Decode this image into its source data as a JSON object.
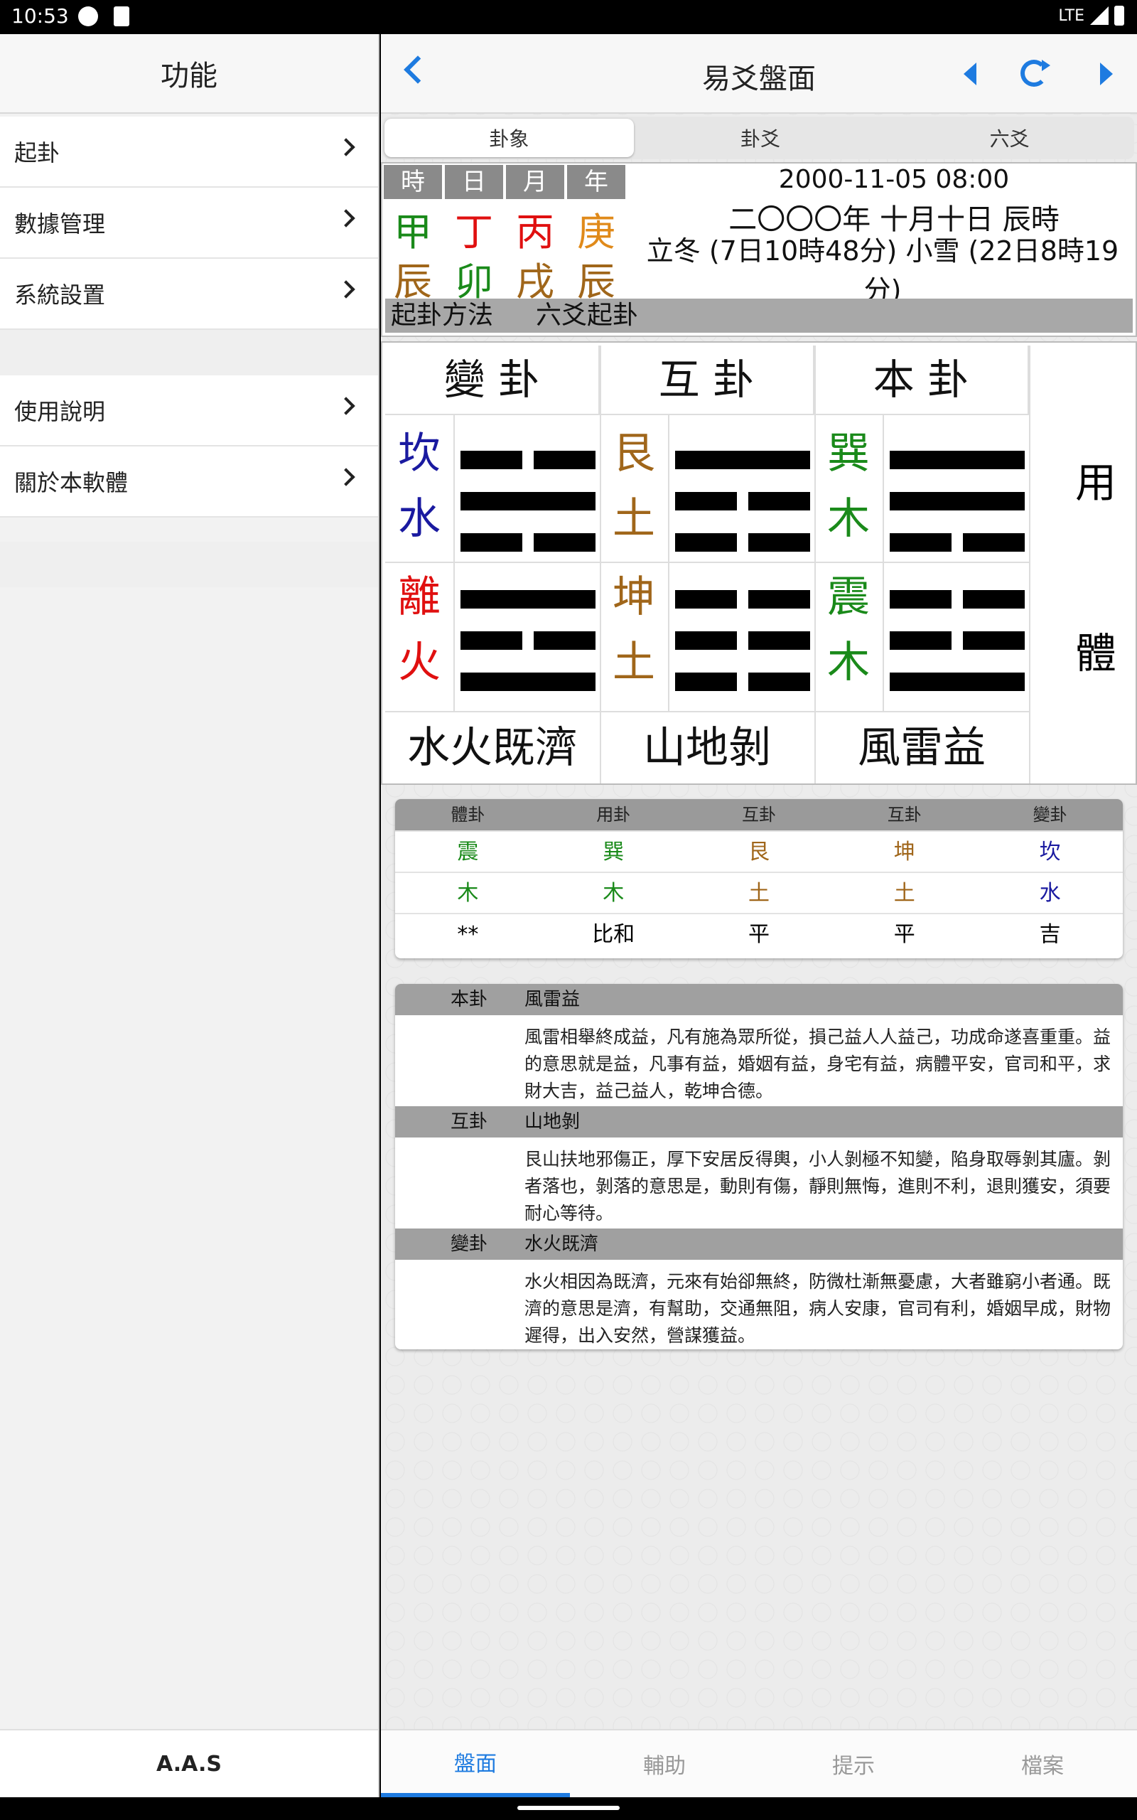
{
  "status": {
    "time": "10:53",
    "network": "LTE"
  },
  "sidebar": {
    "title": "功能",
    "items": [
      {
        "label": "起卦"
      },
      {
        "label": "數據管理"
      },
      {
        "label": "系統設置"
      },
      {
        "label": "使用說明"
      },
      {
        "label": "關於本軟體"
      }
    ],
    "footer": "A.A.S"
  },
  "header": {
    "title": "易爻盤面"
  },
  "tabs": [
    "卦象",
    "卦爻",
    "六爻"
  ],
  "pillars": {
    "headers": [
      "時",
      "日",
      "月",
      "年"
    ],
    "stems": [
      {
        "text": "甲",
        "color": "#1a8a1a"
      },
      {
        "text": "丁",
        "color": "#e01010"
      },
      {
        "text": "丙",
        "color": "#e01010"
      },
      {
        "text": "庚",
        "color": "#e08a1a"
      }
    ],
    "branches": [
      {
        "text": "辰",
        "color": "#a0661a"
      },
      {
        "text": "卯",
        "color": "#1a8a1a"
      },
      {
        "text": "戌",
        "color": "#a0661a"
      },
      {
        "text": "辰",
        "color": "#a0661a"
      }
    ]
  },
  "date": {
    "solar": "2000-11-05 08:00",
    "lunar": "二〇〇〇年 十月十日 辰時",
    "terms": "立冬 (7日10時48分) 小雪 (22日8時19分)"
  },
  "method": {
    "label": "起卦方法",
    "value": "六爻起卦"
  },
  "hexagrams": {
    "headers": [
      "變 卦",
      "互 卦",
      "本 卦"
    ],
    "columns": [
      {
        "upper": [
          "坎",
          "水"
        ],
        "upper_color": "#1a1aa0",
        "lower": [
          "離",
          "火"
        ],
        "lower_color": "#e01010",
        "name": "水火既濟"
      },
      {
        "upper": [
          "艮",
          "土"
        ],
        "upper_color": "#a0661a",
        "lower": [
          "坤",
          "土"
        ],
        "lower_color": "#a0661a",
        "name": "山地剝"
      },
      {
        "upper": [
          "巽",
          "木"
        ],
        "upper_color": "#1a8a1a",
        "lower": [
          "震",
          "木"
        ],
        "lower_color": "#1a8a1a",
        "name": "風雷益"
      }
    ],
    "side": {
      "upper": "用",
      "lower": "體"
    }
  },
  "relation": {
    "headers": [
      "體卦",
      "用卦",
      "互卦",
      "互卦",
      "變卦"
    ],
    "trigrams": [
      {
        "text": "震",
        "color": "#1a8a1a"
      },
      {
        "text": "巽",
        "color": "#1a8a1a"
      },
      {
        "text": "艮",
        "color": "#a0661a"
      },
      {
        "text": "坤",
        "color": "#a0661a"
      },
      {
        "text": "坎",
        "color": "#1a1aa0"
      }
    ],
    "elements": [
      {
        "text": "木",
        "color": "#1a8a1a"
      },
      {
        "text": "木",
        "color": "#1a8a1a"
      },
      {
        "text": "土",
        "color": "#a0661a"
      },
      {
        "text": "土",
        "color": "#a0661a"
      },
      {
        "text": "水",
        "color": "#1a1aa0"
      }
    ],
    "results": [
      "**",
      "比和",
      "平",
      "平",
      "吉"
    ]
  },
  "descriptions": [
    {
      "key": "本卦",
      "name": "風雷益",
      "text": "風雷相舉終成益，凡有施為眾所從，損己益人人益己，功成命遂喜重重。益的意思就是益，凡事有益，婚姻有益，身宅有益，病體平安，官司和平，求財大吉，益己益人，乾坤合德。"
    },
    {
      "key": "互卦",
      "name": "山地剝",
      "text": "艮山扶地邪傷正，厚下安居反得輿，小人剝極不知變，陷身取辱剝其廬。剝者落也，剝落的意思是，動則有傷，靜則無悔，進則不利，退則獲安，須要耐心等待。"
    },
    {
      "key": "變卦",
      "name": "水火既濟",
      "text": "水火相因為既濟，元來有始卻無終，防微杜漸無憂慮，大者雖窮小者通。既濟的意思是濟，有幫助，交通無阻，病人安康，官司有利，婚姻早成，財物遲得，出入安然，營謀獲益。"
    }
  ],
  "bottom_tabs": [
    "盤面",
    "輔助",
    "提示",
    "檔案"
  ],
  "colors": {
    "accent": "#1e7be0"
  }
}
